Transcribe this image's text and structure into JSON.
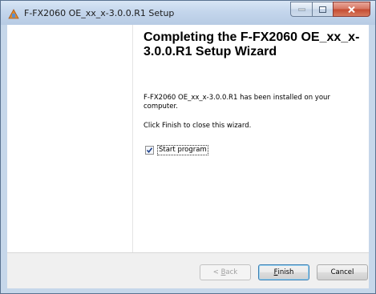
{
  "window": {
    "title": "F-FX2060 OE_xx_x-3.0.0.R1 Setup",
    "icon": "installer-icon"
  },
  "main": {
    "heading": "Completing the F-FX2060 OE_xx_x-3.0.0.R1 Setup Wizard",
    "installed_text": "F-FX2060 OE_xx_x-3.0.0.R1 has been installed on your computer.",
    "finish_text": "Click Finish to close this wizard.",
    "start_program": {
      "label": "Start program",
      "checked": true
    }
  },
  "buttons": {
    "back": {
      "mnemonic": "B",
      "rest": "ack",
      "prefix": "< "
    },
    "finish": {
      "mnemonic": "F",
      "rest": "inish"
    },
    "cancel": "Cancel"
  },
  "colors": {
    "titlebar": "#c4d6ec",
    "close_button": "#c44a30",
    "default_button_border": "#3c7fb1"
  }
}
